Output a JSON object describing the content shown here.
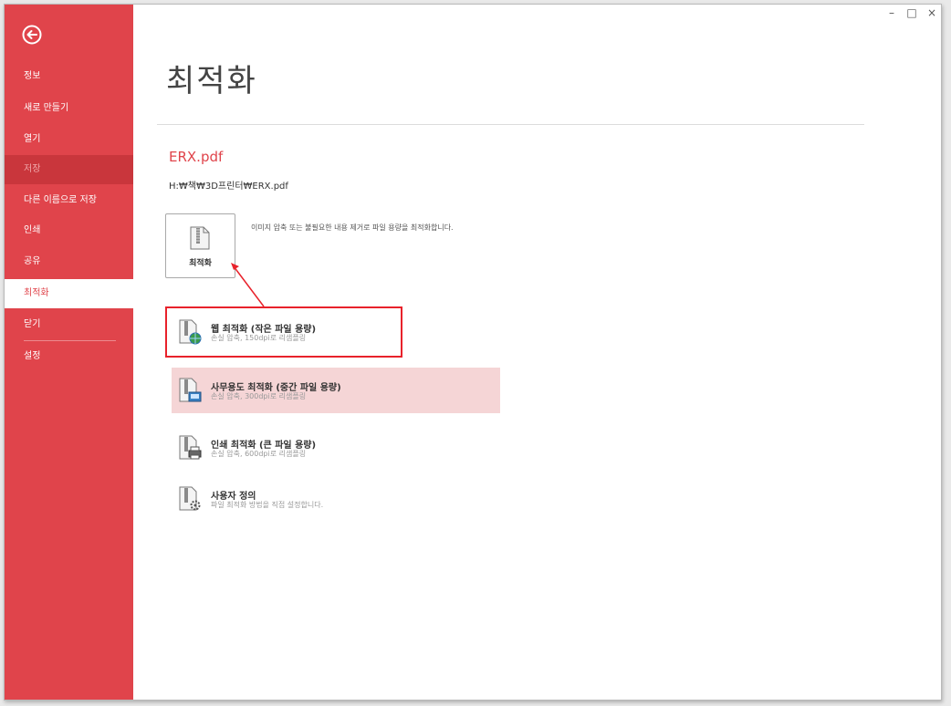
{
  "window": {
    "controls": {
      "minimize": "–",
      "maximize": "□",
      "close": "×"
    }
  },
  "sidebar": {
    "back_icon": "back-arrow-circle-icon",
    "items": [
      {
        "label": "정보"
      },
      {
        "label": "새로 만들기"
      },
      {
        "label": "열기"
      },
      {
        "label": "저장"
      },
      {
        "label": "다른 이름으로 저장"
      },
      {
        "label": "인쇄"
      },
      {
        "label": "공유"
      },
      {
        "label": "최적화"
      },
      {
        "label": "닫기"
      },
      {
        "label": "설정"
      }
    ],
    "active_item": "최적화",
    "disabled_item": "저장"
  },
  "main": {
    "title": "최적화",
    "file_name": "ERX.pdf",
    "file_path": "H:₩책₩3D프린터₩ERX.pdf",
    "optimize_button": {
      "label": "최적화",
      "icon": "zip-file-icon"
    },
    "optimize_description": "이미지 압축 또는 불필요한 내용 제거로 파일 용량을 최적화합니다.",
    "presets": [
      {
        "title": "웹 최적화 (작은 파일 용량)",
        "subtitle": "손실 압축, 150dpi로 리샘플링",
        "icon": "zip-web-globe-icon",
        "annotated": true
      },
      {
        "title": "사무용도 최적화 (중간 파일 용량)",
        "subtitle": "손실 압축, 300dpi로 리샘플링",
        "icon": "zip-office-monitor-icon",
        "hovered": true
      },
      {
        "title": "인쇄 최적화 (큰 파일 용량)",
        "subtitle": "손실 압축, 600dpi로 리샘플링",
        "icon": "zip-printer-icon"
      },
      {
        "title": "사용자 정의",
        "subtitle": "파일 최적화 방법을 직접 설정합니다.",
        "icon": "zip-gear-icon"
      }
    ]
  },
  "colors": {
    "accent": "#e0444b",
    "sidebar_disabled_bg": "#c9363c",
    "hover_highlight": "#f5d5d6",
    "annotation_red": "#e8222b"
  }
}
